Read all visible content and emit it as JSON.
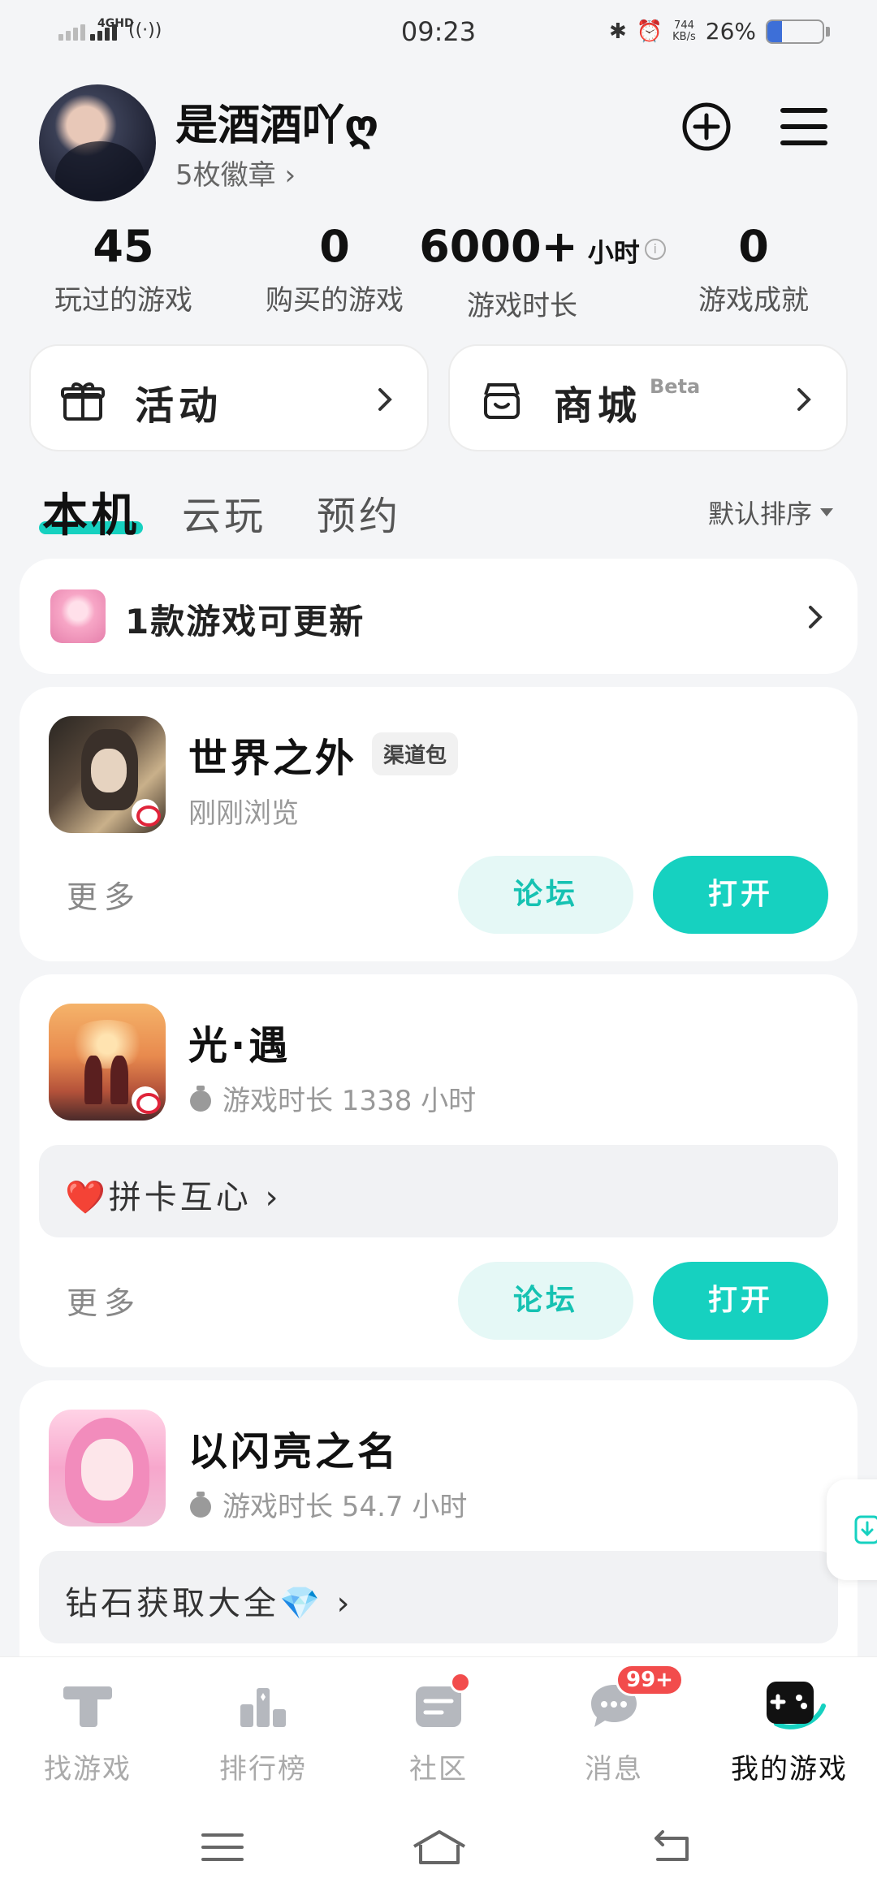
{
  "status_bar": {
    "network": "4GHD",
    "time": "09:23",
    "speed_value": "744",
    "speed_unit": "KB/s",
    "battery_text": "26%",
    "battery_level": 0.26
  },
  "profile": {
    "nickname": "是酒酒吖ღ",
    "badges": "5枚徽章 ›"
  },
  "stats": [
    {
      "value": "45",
      "label": "玩过的游戏"
    },
    {
      "value": "0",
      "label": "购买的游戏"
    },
    {
      "value": "6000+",
      "unit": "小时",
      "label": "游戏时长"
    },
    {
      "value": "0",
      "label": "游戏成就"
    }
  ],
  "features": {
    "activity": "活动",
    "shop": "商城",
    "shop_tag": "Beta"
  },
  "tabs": [
    "本机",
    "云玩",
    "预约"
  ],
  "sort_label": "默认排序",
  "update_banner": "1款游戏可更新",
  "games": [
    {
      "title": "世界之外",
      "tag": "渠道包",
      "subtitle": "刚刚浏览",
      "more": "更多",
      "forum": "论坛",
      "open": "打开"
    },
    {
      "title": "光·遇",
      "subtitle": "游戏时长 1338 小时",
      "promo": "❤️拼卡互心 ›",
      "more": "更多",
      "forum": "论坛",
      "open": "打开"
    },
    {
      "title": "以闪亮之名",
      "subtitle": "游戏时长 54.7 小时",
      "promo": "钻石获取大全💎 ›"
    }
  ],
  "bottom_nav": [
    {
      "label": "找游戏"
    },
    {
      "label": "排行榜"
    },
    {
      "label": "社区"
    },
    {
      "label": "消息",
      "badge": "99+"
    },
    {
      "label": "我的游戏"
    }
  ],
  "colors": {
    "accent": "#16d1c0",
    "accent_light": "#e5f8f6",
    "badge_red": "#f24c4c"
  }
}
